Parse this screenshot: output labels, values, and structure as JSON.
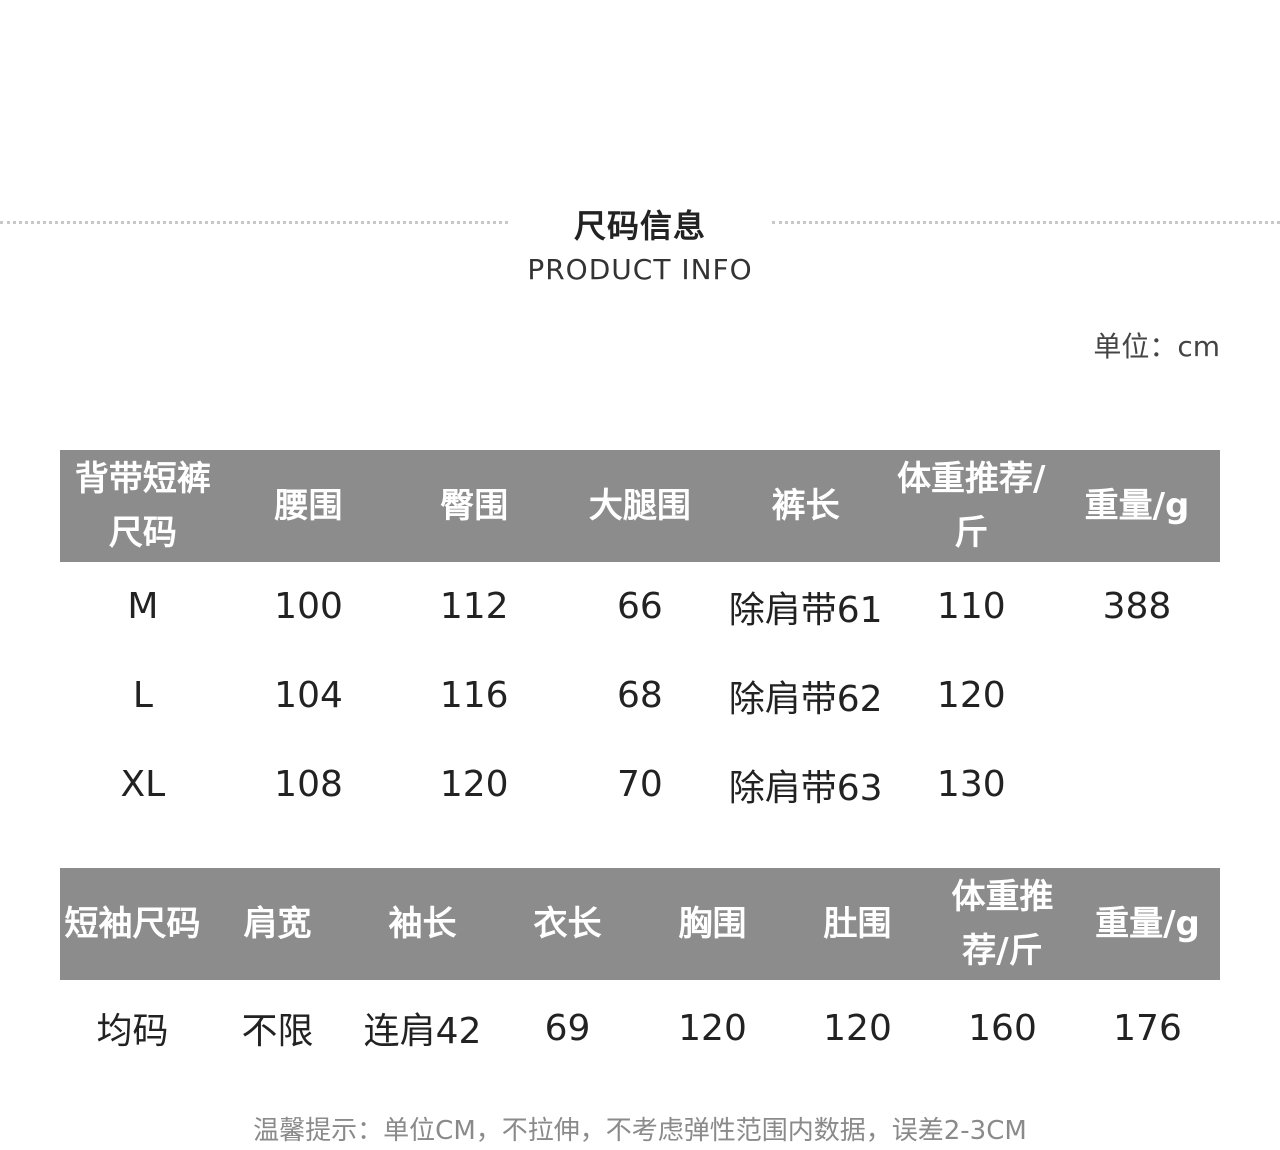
{
  "header": {
    "title_cn": "尺码信息",
    "title_en": "PRODUCT INFO"
  },
  "unit_label": "单位：cm",
  "table1": {
    "headers": [
      "背带短裤尺码",
      "腰围",
      "臀围",
      "大腿围",
      "裤长",
      "体重推荐/斤",
      "重量/g"
    ],
    "rows": [
      [
        "M",
        "100",
        "112",
        "66",
        "除肩带61",
        "110",
        "388"
      ],
      [
        "L",
        "104",
        "116",
        "68",
        "除肩带62",
        "120",
        ""
      ],
      [
        "XL",
        "108",
        "120",
        "70",
        "除肩带63",
        "130",
        ""
      ]
    ]
  },
  "table2": {
    "headers": [
      "短袖尺码",
      "肩宽",
      "袖长",
      "衣长",
      "胸围",
      "肚围",
      "体重推荐/斤",
      "重量/g"
    ],
    "rows": [
      [
        "均码",
        "不限",
        "连肩42",
        "69",
        "120",
        "120",
        "160",
        "176"
      ]
    ]
  },
  "footer_note": "温馨提示：单位CM，不拉伸，不考虑弹性范围内数据，误差2-3CM"
}
